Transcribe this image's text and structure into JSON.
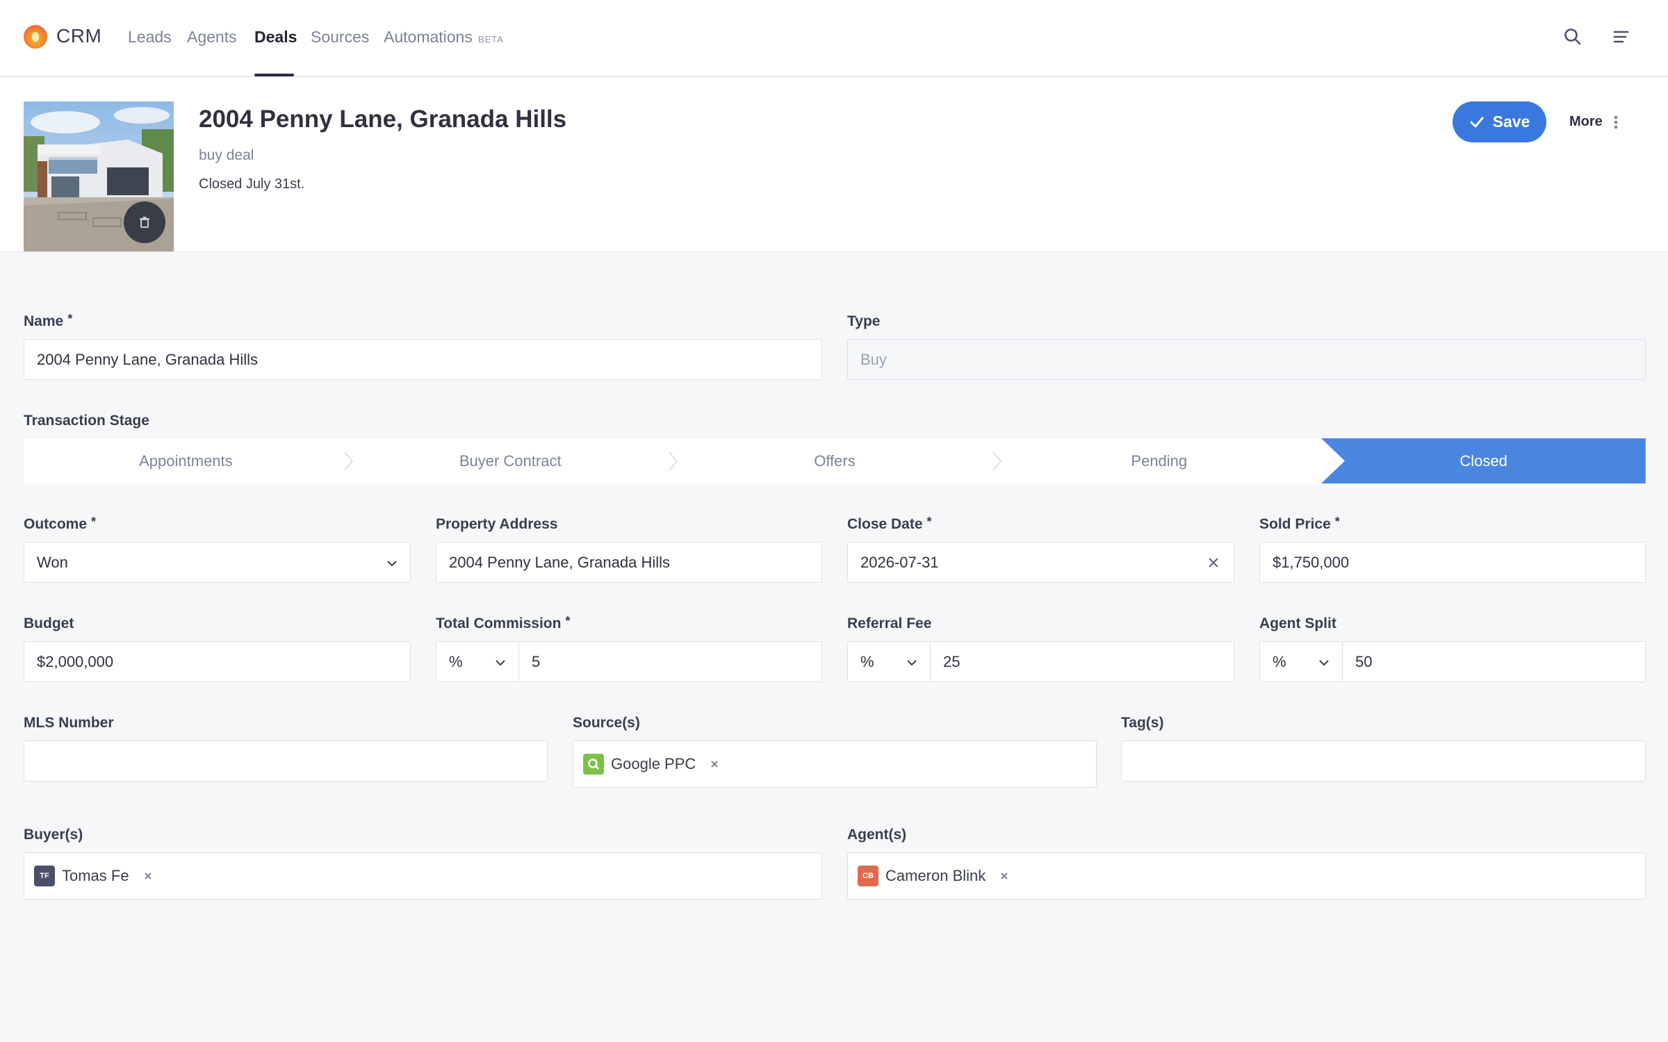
{
  "nav": {
    "brand": "CRM",
    "items": [
      {
        "label": "Leads"
      },
      {
        "label": "Agents"
      },
      {
        "label": "Deals"
      },
      {
        "label": "Sources"
      },
      {
        "label": "Automations",
        "badge": "BETA"
      }
    ],
    "active": "Deals"
  },
  "header": {
    "title": "2004 Penny Lane, Granada Hills",
    "subtitle": "buy deal",
    "note": "Closed July 31st.",
    "save_label": "Save",
    "more_label": "More"
  },
  "form": {
    "name": {
      "label": "Name",
      "required": "*",
      "value": "2004 Penny Lane, Granada Hills"
    },
    "type": {
      "label": "Type",
      "value": "Buy"
    },
    "transaction_stage": {
      "label": "Transaction Stage",
      "stages": [
        "Appointments",
        "Buyer Contract",
        "Offers",
        "Pending",
        "Closed"
      ],
      "current": "Closed"
    },
    "outcome": {
      "label": "Outcome",
      "required": "*",
      "value": "Won"
    },
    "property_address": {
      "label": "Property Address",
      "value": "2004 Penny Lane, Granada Hills"
    },
    "close_date": {
      "label": "Close Date",
      "required": "*",
      "value": "2026-07-31"
    },
    "sold_price": {
      "label": "Sold Price",
      "required": "*",
      "value": "$1,750,000"
    },
    "budget": {
      "label": "Budget",
      "value": "$2,000,000"
    },
    "total_commission": {
      "label": "Total Commission",
      "required": "*",
      "unit": "%",
      "value": "5"
    },
    "referral_fee": {
      "label": "Referral Fee",
      "unit": "%",
      "value": "25"
    },
    "agent_split": {
      "label": "Agent Split",
      "unit": "%",
      "value": "50"
    },
    "mls_number": {
      "label": "MLS Number",
      "value": ""
    },
    "sources": {
      "label": "Source(s)",
      "chips": [
        {
          "label": "Google PPC",
          "icon": "search-icon"
        }
      ]
    },
    "tags": {
      "label": "Tag(s)",
      "chips": []
    },
    "buyers": {
      "label": "Buyer(s)",
      "chips": [
        {
          "label": "Tomas Fe",
          "initials": "TF"
        }
      ]
    },
    "agents": {
      "label": "Agent(s)",
      "chips": [
        {
          "label": "Cameron Blink",
          "initials": "CB"
        }
      ]
    }
  },
  "colors": {
    "accent": "#3a78e0",
    "stage_active": "#4a86e0",
    "buyer_badge": "#4b5068",
    "agent_badge": "#e06a4b",
    "source_badge": "#7cc04a"
  }
}
